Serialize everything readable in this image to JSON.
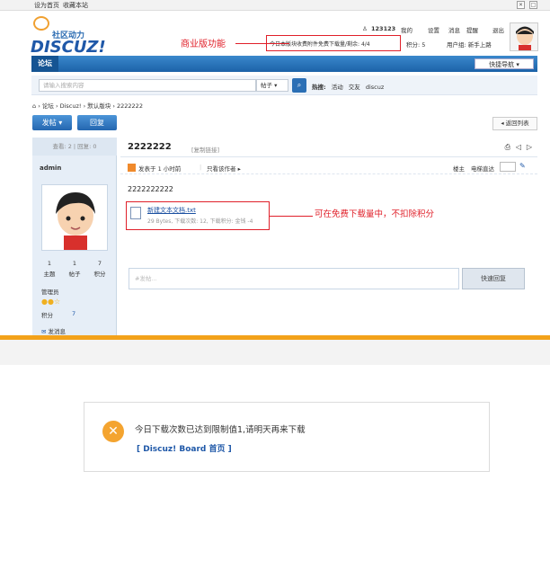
{
  "topbar": {
    "set_home": "设为首页",
    "bookmark": "收藏本站"
  },
  "logo": {
    "cn": "社区动力",
    "en": "DISCUZ!"
  },
  "userbar": {
    "username": "123123",
    "my": "我的",
    "settings": "设置",
    "messages": "消息",
    "reminders": "提醒",
    "logout": "退出",
    "download_notice": "今日本版块收费附件免费下载量/剩余: 4/4",
    "credits": "积分: 5",
    "usergroup": "用户组: 新手上路"
  },
  "annotations": {
    "commercial": "商业版功能",
    "free_download": "可在免费下载量中，不扣除积分"
  },
  "nav": {
    "forum_tab": "论坛",
    "quick_nav": "快捷导航"
  },
  "search": {
    "placeholder": "请输入搜索内容",
    "scope": "帖子",
    "hot_label": "热搜:",
    "hot_terms": [
      "活动",
      "交友",
      "discuz"
    ]
  },
  "breadcrumb": [
    "论坛",
    "Discuz!",
    "默认版块",
    "2222222"
  ],
  "actions": {
    "post": "发帖",
    "reply": "回复",
    "back": "返回列表"
  },
  "thread": {
    "stats": "查看: 2 | 回复: 0",
    "title": "2222222",
    "copy_link": "[复制链接]",
    "author": "admin",
    "posted": "发表于 1 小时前",
    "author_only": "只看该作者",
    "floor": "楼主",
    "jump": "电梯直达",
    "content": "2222222222",
    "attachment": {
      "name": "新建文本文档.txt",
      "info": "29 Bytes, 下载次数: 12, 下载积分: 金钱 -4"
    }
  },
  "user_stats": [
    {
      "value": "1",
      "label": "主题"
    },
    {
      "value": "1",
      "label": "帖子"
    },
    {
      "value": "7",
      "label": "积分"
    }
  ],
  "user_role": "管理员",
  "user_credit_label": "积分",
  "user_credit_value": "7",
  "send_message": "发消息",
  "quick_reply": {
    "placeholder": "#发帖...",
    "button": "快速回复"
  },
  "message": {
    "text": "今日下载次数已达到限制值1,请明天再来下载",
    "link": "[ Discuz! Board 首页 ]"
  }
}
